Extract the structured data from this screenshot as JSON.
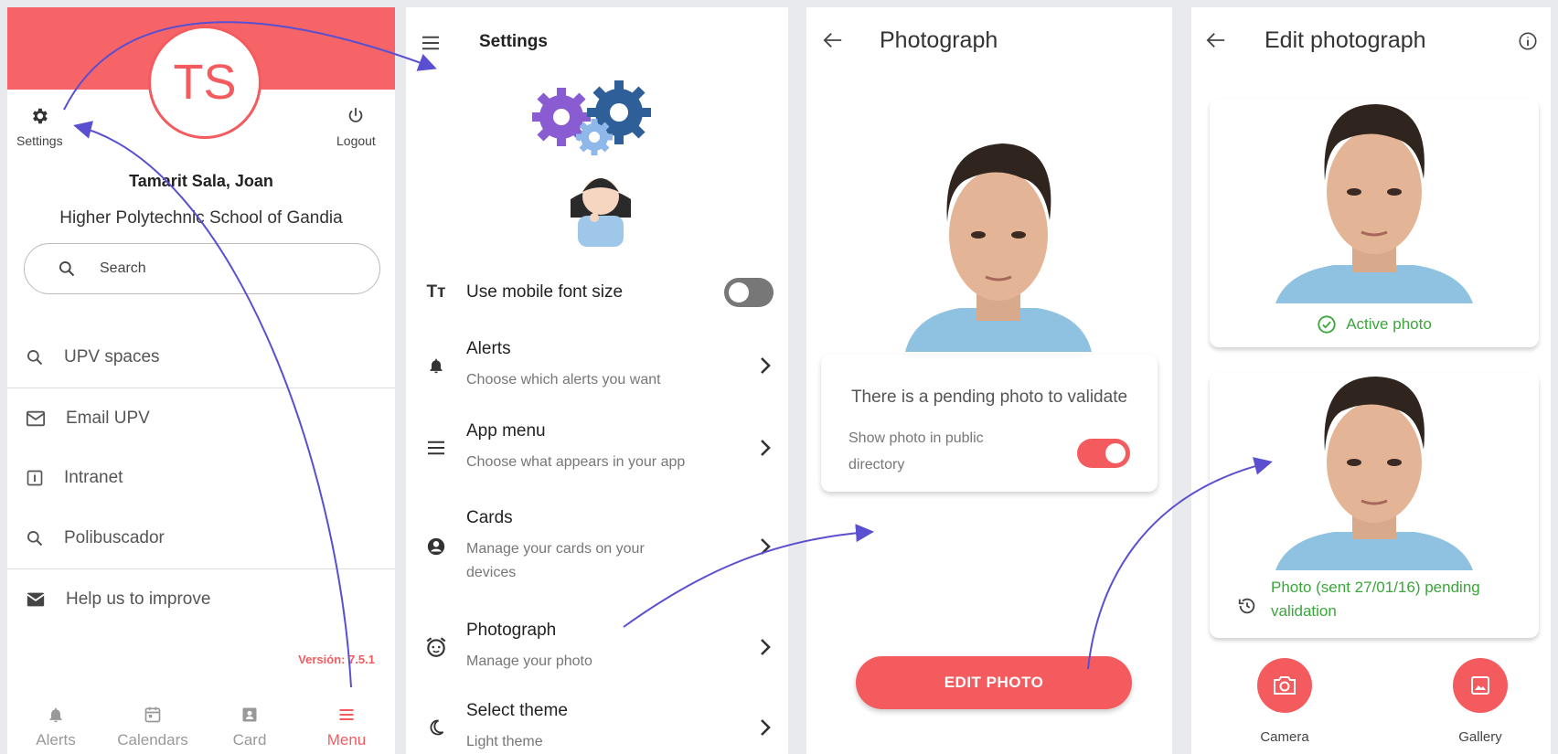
{
  "colors": {
    "accent": "#f45b5f",
    "success": "#3ca53c",
    "arrow": "#5a4fd0"
  },
  "screen1": {
    "avatar_initials": "TS",
    "settings_label": "Settings",
    "logout_label": "Logout",
    "user_name": "Tamarit Sala, Joan",
    "school": "Higher Polytechnic School of Gandia",
    "search_placeholder": "Search",
    "menu_items": [
      {
        "label": "UPV spaces",
        "icon": "search-icon"
      },
      {
        "label": "Email UPV",
        "icon": "mail-icon"
      },
      {
        "label": "Intranet",
        "icon": "intranet-icon"
      },
      {
        "label": "Polibuscador",
        "icon": "search-icon"
      },
      {
        "label": "Help us to improve",
        "icon": "mail-icon"
      }
    ],
    "version": "Versión: 7.5.1",
    "tabs": [
      {
        "label": "Alerts",
        "icon": "bell-icon"
      },
      {
        "label": "Calendars",
        "icon": "calendar-icon"
      },
      {
        "label": "Card",
        "icon": "card-icon"
      },
      {
        "label": "Menu",
        "icon": "menu-icon",
        "active": true
      }
    ]
  },
  "screen2": {
    "title": "Settings",
    "rows": [
      {
        "title": "Use mobile font size",
        "subtitle": "",
        "icon": "font-size-icon",
        "control": "toggle-off"
      },
      {
        "title": "Alerts",
        "subtitle": "Choose which alerts you want",
        "icon": "bell-icon"
      },
      {
        "title": "App menu",
        "subtitle": "Choose what appears in your app",
        "icon": "menu-icon"
      },
      {
        "title": "Cards",
        "subtitle": "Manage your cards on your devices",
        "icon": "account-icon"
      },
      {
        "title": "Photograph",
        "subtitle": "Manage your photo",
        "icon": "alarm-face-icon"
      },
      {
        "title": "Select theme",
        "subtitle": "Light theme",
        "icon": "moon-icon"
      }
    ]
  },
  "screen3": {
    "title": "Photograph",
    "pending_text": "There is a pending photo to validate",
    "public_directory_label": "Show photo in public directory",
    "public_directory_on": true,
    "edit_button": "EDIT PHOTO"
  },
  "screen4": {
    "title": "Edit photograph",
    "active_status": "Active photo",
    "pending_status": "Photo (sent 27/01/16) pending validation",
    "camera_label": "Camera",
    "gallery_label": "Gallery"
  }
}
